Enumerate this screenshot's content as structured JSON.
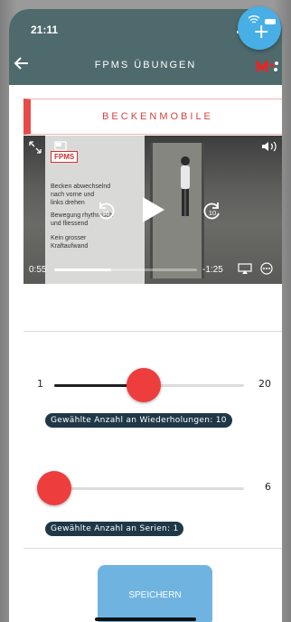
{
  "status_bar": {
    "time": "21:11"
  },
  "header": {
    "title": "FPMS ÜBUNGEN",
    "back_icon": "arrow-left-icon",
    "logo_icon": "fpms-logo-icon"
  },
  "fab": {
    "icon": "plus-icon"
  },
  "exercise": {
    "name": "BECKENMOBILE"
  },
  "video": {
    "overlay_logo": "FPMS",
    "overlay_lines": [
      "Becken abwechselnd",
      "nach vorne und",
      "links drehen",
      "",
      "Bewegung rhythmisch",
      "und fliessend",
      "",
      "Kein grosser",
      "Kraftaufwand"
    ],
    "elapsed": "0:55",
    "remaining": "-1:25",
    "progress": 0.4,
    "skip_back": "10",
    "skip_forward": "10"
  },
  "repetitions": {
    "min": "1",
    "max": "20",
    "value": 10,
    "range": [
      1,
      20
    ],
    "label": "Gewählte Anzahl an Wiederholungen: 10"
  },
  "series": {
    "min": "",
    "max": "6",
    "value": 1,
    "range": [
      1,
      6
    ],
    "label": "Gewählte Anzahl an Serien: 1"
  },
  "save": {
    "label": "SPEICHERN"
  },
  "colors": {
    "header": "#4f6a6c",
    "accent_red": "#ee3d3d",
    "chip": "#1f3847",
    "save": "#6fb4e0",
    "fab": "#48aee6"
  }
}
